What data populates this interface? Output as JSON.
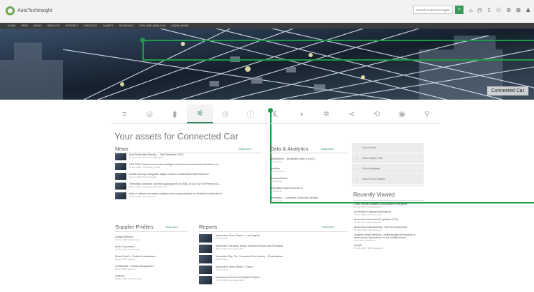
{
  "header": {
    "brand": "AutoTechInsight",
    "search_placeholder": "Search AutoTechInsight",
    "search_button": "»",
    "utility_icons": [
      "home-icon",
      "print-icon",
      "share-icon",
      "user-icon",
      "settings-icon",
      "lock-icon",
      "profile-icon",
      "more-icon"
    ]
  },
  "nav": {
    "items": [
      "HOME",
      "FEED",
      "NEWS",
      "INSIGHTS",
      "REPORTS",
      "PROFILES",
      "CHARTS",
      "SEARCHES",
      "EXPLORE MODULES",
      "LEARN MORE"
    ]
  },
  "hero": {
    "caption": "Connected Car"
  },
  "icon_tabs": [
    {
      "name": "powertrain-icon",
      "glyph": "≡"
    },
    {
      "name": "chassis-icon",
      "glyph": "◎"
    },
    {
      "name": "body-icon",
      "glyph": "▮"
    },
    {
      "name": "connected-car-icon",
      "glyph": "⚟"
    },
    {
      "name": "safety-icon",
      "glyph": "◷"
    },
    {
      "name": "infotainment-icon",
      "glyph": "ⓘ"
    },
    {
      "name": "telematics-icon",
      "glyph": "℄"
    },
    {
      "name": "lighting-icon",
      "glyph": "◑"
    },
    {
      "name": "autonomous-icon",
      "glyph": "✲"
    },
    {
      "name": "interior-icon",
      "glyph": "⋖"
    },
    {
      "name": "electrification-icon",
      "glyph": "⟲"
    },
    {
      "name": "sensors-icon",
      "glyph": "◉"
    },
    {
      "name": "semiconductors-icon",
      "glyph": "⚲"
    }
  ],
  "page_title": "Your assets for Connected Car",
  "news": {
    "heading": "News",
    "more": "Read more ›",
    "items": [
      {
        "title": "AutoTechInsight Weekly — 16th December 2016",
        "meta": "19 Dec 2016 | AutoTechInsight News"
      },
      {
        "title": "CES 2020: Bosch to showcase intelligent front camera and advanced interior mo...",
        "meta": "18 Dec 2016 | Technology Trends"
      },
      {
        "title": "Mobile develops integrated digital cockpit in collaboration with Redbend",
        "meta": "19 Dec 2016 | Tech Products"
      },
      {
        "title": "Telematics hardware monthly supply growth of US$1.2B cap due for Premium ca...",
        "meta": "19 Dec 2016 | Corporate Announcement"
      },
      {
        "title": "Apto to release new major updates to its cockpit platform for Redbend in first half of...",
        "meta": "19 Dec 2016 | Tech Products"
      }
    ]
  },
  "data_analytics": {
    "heading": "Data & Analytics",
    "more": "Read more ›",
    "items": [
      {
        "title": "Infotainment – Broadcast audio (Level 4)",
        "meta": "Components"
      },
      {
        "title": "Amplifier",
        "meta": "ADAS Platforms"
      },
      {
        "title": "Standard Audio",
        "meta": "Components"
      },
      {
        "title": "Telematics Systems (Level 4)",
        "meta": "Components"
      },
      {
        "title": "Telematics – Consumer Electronics Module",
        "meta": "Components"
      }
    ]
  },
  "goto": {
    "items": [
      "Go to Feed",
      "Go to Query Tool",
      "Go to Analytics",
      "Go to Feed Tracker"
    ]
  },
  "recent": {
    "heading": "Recently Viewed",
    "items": [
      {
        "title": "Chart Vehicle Updates: Real Market Emergence",
        "meta": "20 Aug 2017 | Connected Car"
      },
      {
        "title": "Automotive Cybersecurity Report",
        "meta": "20 Sep 2016 | Connected Car"
      },
      {
        "title": "Automotive Over-the-Air Updates (OTA)",
        "meta": "20 Jan 2016 | Connected Car"
      },
      {
        "title": "Automotive Cybersecurity: Time for Deployment",
        "meta": "20 May 2016 | Connected Car"
      },
      {
        "title": "Supplier Insight Webinar: Understanding the impacts of autonomous applications on the mobility sector",
        "meta": "21 Jul 2016 | Webinars"
      },
      {
        "title": "Google",
        "meta": "05 Sep 2016 | Tech Developers"
      }
    ]
  },
  "suppliers": {
    "heading": "Supplier Profiles",
    "more": "Read more ›",
    "items": [
      {
        "title": "Langou Epimeer",
        "meta": "14 Dec 2016 | Global View"
      },
      {
        "title": "Aisin Corporation",
        "meta": "23 Dec 2016 | Asia-Pacific"
      },
      {
        "title": "Brose GmbH – Global Headquarters",
        "meta": "20 Dec 2016 | Europe"
      },
      {
        "title": "Continental – Global Headquarters",
        "meta": "20 Dec 2016 | Europe"
      },
      {
        "title": "Cerence",
        "meta": "20 Dec 2016 | North America"
      }
    ]
  },
  "reports": {
    "heading": "Reports",
    "more": "Read more ›",
    "items": [
      {
        "title": "Automotive Show Report – Los Angeles",
        "meta": "20 Dec 2016"
      },
      {
        "title": "Automotive Services, Space Software Report (and Forecast)",
        "meta": "20 Dec 2016 | Connected Car"
      },
      {
        "title": "Innovation Day: The Connected Car Journey – Presentations",
        "meta": "20 Dec 2016"
      },
      {
        "title": "Automotive Show Report – Tokyo",
        "meta": "20 Nov 2016"
      },
      {
        "title": "Infotainment Head Unit Systems Report",
        "meta": "17 Nov 2016 | Connected Car"
      }
    ]
  },
  "colors": {
    "accent": "#1f9a48",
    "nav": "#3d3d3d",
    "header": "#f2f2f2"
  }
}
